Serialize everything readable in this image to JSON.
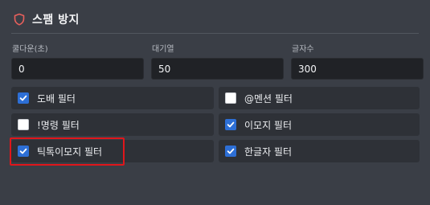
{
  "panel": {
    "title": "스팸 방지",
    "icon": "shield-icon",
    "icon_color": "#e8605c"
  },
  "fields": [
    {
      "label": "쿨다운(초)",
      "value": "0"
    },
    {
      "label": "대기열",
      "value": "50"
    },
    {
      "label": "글자수",
      "value": "300"
    }
  ],
  "filters": [
    {
      "label": "도배 필터",
      "checked": true
    },
    {
      "label": "@멘션 필터",
      "checked": false
    },
    {
      "label": "!명령 필터",
      "checked": false
    },
    {
      "label": "이모지 필터",
      "checked": true
    },
    {
      "label": "틱톡이모지 필터",
      "checked": true,
      "highlighted": true
    },
    {
      "label": "한글자 필터",
      "checked": true
    }
  ],
  "colors": {
    "checkbox_checked": "#2d6fd6",
    "highlight_border": "#e0161b",
    "background": "#3a3e46"
  }
}
